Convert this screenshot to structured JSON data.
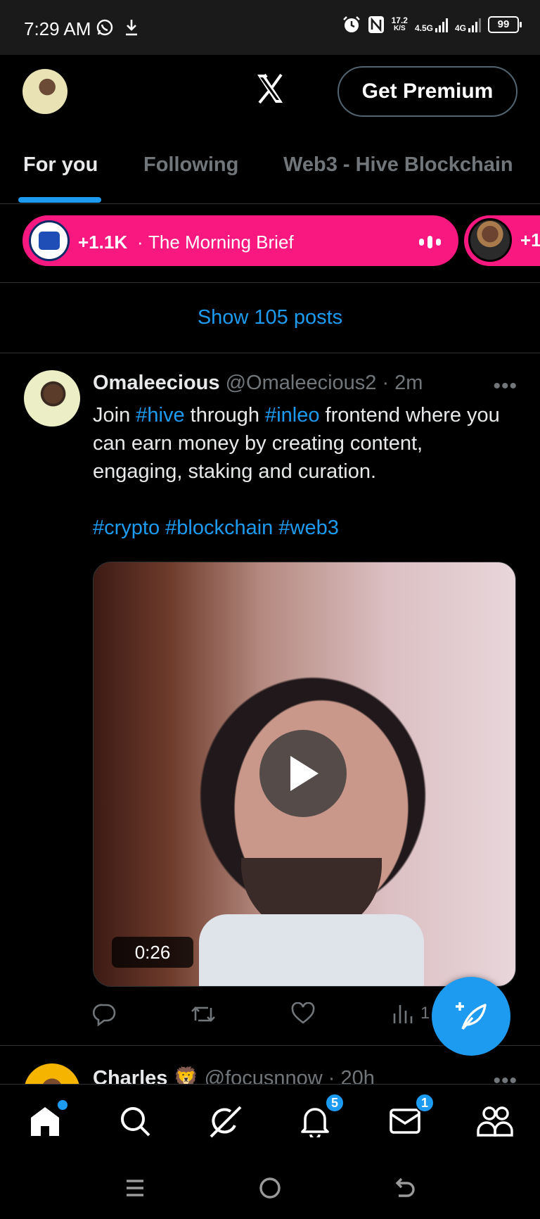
{
  "status_bar": {
    "time": "7:29 AM",
    "net_speed_value": "17.2",
    "net_speed_unit": "K/S",
    "net1": "4.5G",
    "net2": "4G",
    "battery": "99"
  },
  "header": {
    "premium_label": "Get Premium"
  },
  "tabs": [
    {
      "label": "For you",
      "active": true
    },
    {
      "label": "Following",
      "active": false
    },
    {
      "label": "Web3 - Hive Blockchain",
      "active": false
    }
  ],
  "spaces": [
    {
      "count": "+1.1K",
      "separator": "·",
      "title": "The Morning Brief"
    },
    {
      "count": "+1"
    }
  ],
  "show_posts": "Show 105 posts",
  "tweet": {
    "name": "Omaleecious",
    "handle": "@Omaleecious2",
    "time": "· 2m",
    "more": "•••",
    "text_1": "Join ",
    "hash_1": "#hive",
    "text_2": " through ",
    "hash_2": "#inleo",
    "text_3": " frontend where you can earn money by creating content, engaging, staking and curation.",
    "tags": "#crypto #blockchain #web3",
    "video_duration": "0:26",
    "views_count": "1"
  },
  "next_tweet": {
    "name": "Charles",
    "emoji": "🦁",
    "handle": "@focusnnow",
    "time": "· 20h",
    "more": "•••"
  },
  "bottom_nav": {
    "notifications_badge": "5",
    "messages_badge": "1"
  },
  "colors": {
    "accent": "#1d9bf0",
    "spaces_pink": "#f91880",
    "background": "#000000",
    "muted": "#71767b"
  },
  "icons": [
    "whatsapp-icon",
    "download-icon",
    "alarm-icon",
    "nfc-icon",
    "x-logo-icon",
    "play-icon",
    "reply-icon",
    "repost-icon",
    "like-icon",
    "views-icon",
    "compose-icon",
    "home-icon",
    "search-icon",
    "grok-icon",
    "bell-icon",
    "mail-icon",
    "communities-icon",
    "menu-icon",
    "circle-home-icon",
    "back-icon"
  ]
}
